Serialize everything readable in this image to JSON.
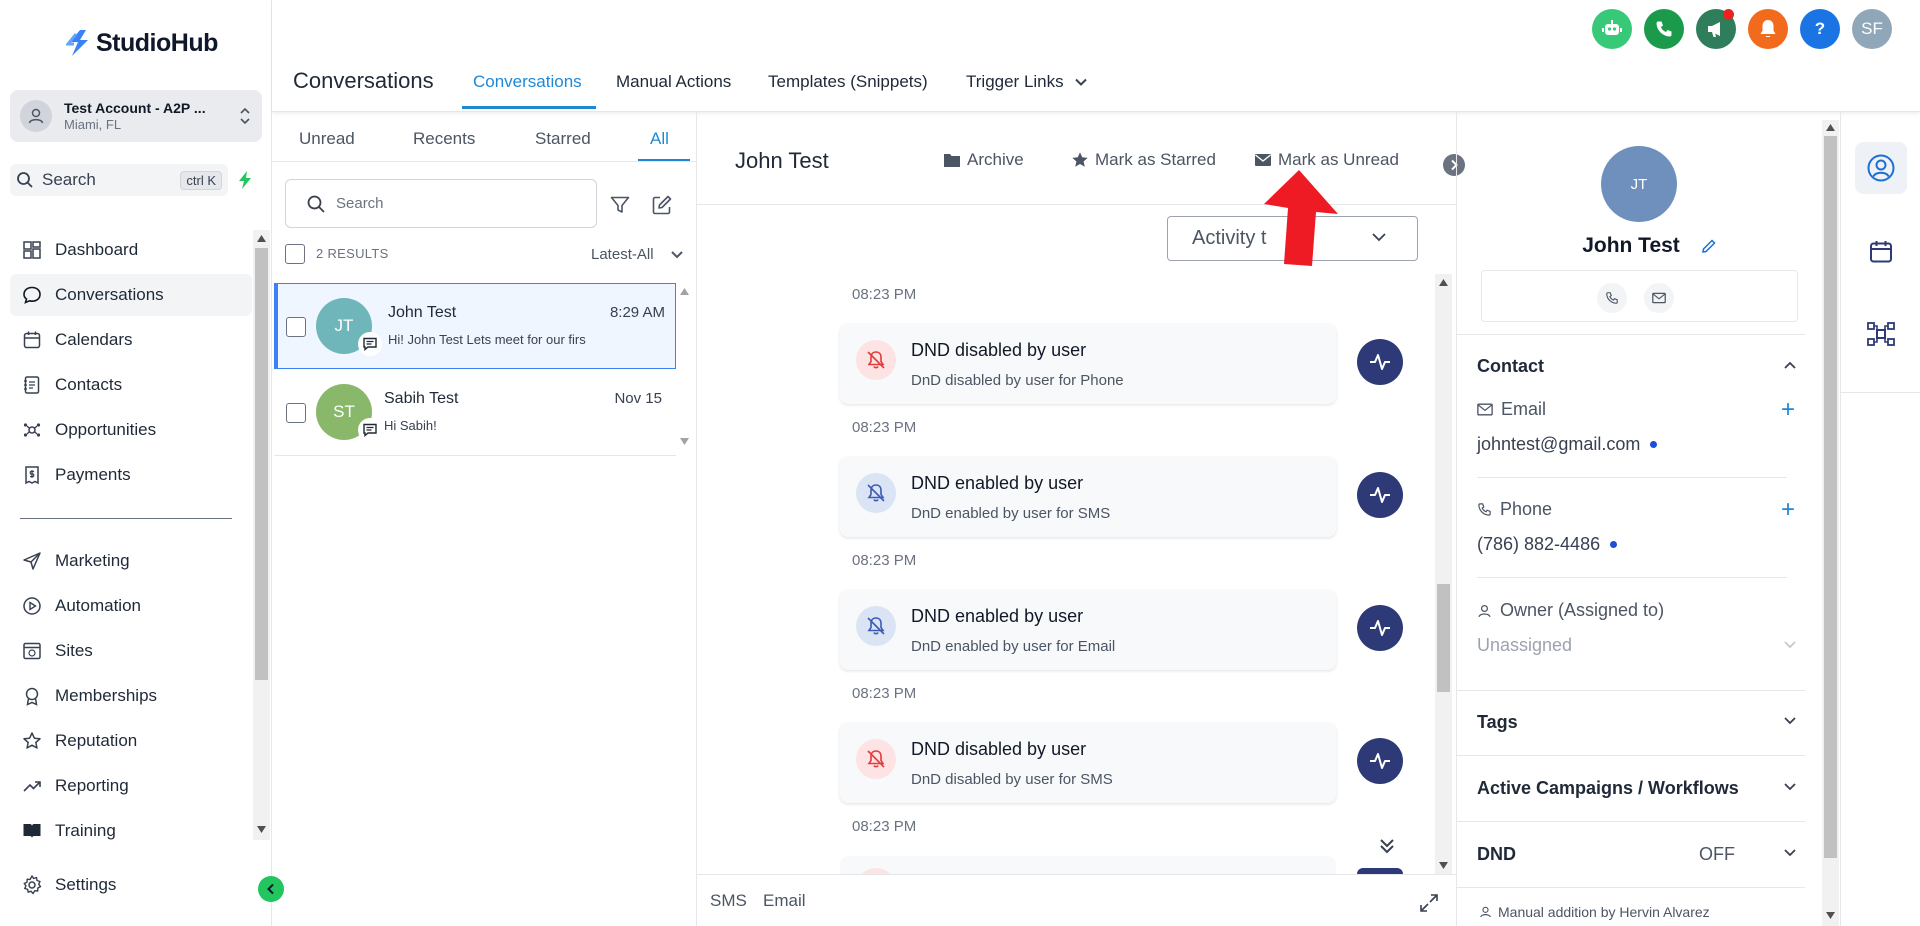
{
  "app": {
    "name": "StudioHub"
  },
  "account": {
    "name": "Test Account - A2P ...",
    "location": "Miami, FL"
  },
  "sidebar": {
    "search_label": "Search",
    "search_shortcut": "ctrl K",
    "items": [
      {
        "label": "Dashboard"
      },
      {
        "label": "Conversations"
      },
      {
        "label": "Calendars"
      },
      {
        "label": "Contacts"
      },
      {
        "label": "Opportunities"
      },
      {
        "label": "Payments"
      },
      {
        "label": "Marketing"
      },
      {
        "label": "Automation"
      },
      {
        "label": "Sites"
      },
      {
        "label": "Memberships"
      },
      {
        "label": "Reputation"
      },
      {
        "label": "Reporting"
      },
      {
        "label": "Training"
      },
      {
        "label": "Settings"
      }
    ]
  },
  "header": {
    "title": "Conversations",
    "tabs": [
      {
        "label": "Conversations"
      },
      {
        "label": "Manual Actions"
      },
      {
        "label": "Templates (Snippets)"
      },
      {
        "label": "Trigger Links"
      }
    ],
    "user_initials": "SF",
    "help_label": "?",
    "colors": {
      "bot": "#37c978",
      "phone": "#1c9a4c",
      "announce": "#2e7d5b",
      "bell": "#f26a1b",
      "help": "#1b74e4",
      "avatar": "#8fa7b8"
    }
  },
  "list": {
    "tabs": [
      {
        "label": "Unread"
      },
      {
        "label": "Recents"
      },
      {
        "label": "Starred"
      },
      {
        "label": "All"
      }
    ],
    "search_placeholder": "Search",
    "results": "2 RESULTS",
    "sort": "Latest-All",
    "conversations": [
      {
        "initials": "JT",
        "name": "John Test",
        "time": "8:29 AM",
        "preview": "Hi! John Test Lets meet for our firs",
        "color": "#6fb6ba"
      },
      {
        "initials": "ST",
        "name": "Sabih Test",
        "time": "Nov 15",
        "preview": "Hi Sabih!",
        "color": "#8ab86a"
      }
    ]
  },
  "chat": {
    "contact_name": "John Test",
    "actions": {
      "archive": "Archive",
      "star": "Mark as Starred",
      "unread": "Mark as Unread"
    },
    "filter": "Activity t",
    "timestamps": [
      "08:23 PM",
      "08:23 PM",
      "08:23 PM",
      "08:23 PM",
      "08:23 PM"
    ],
    "activities": [
      {
        "title": "DND disabled by user",
        "detail": "DnD disabled by user for Phone",
        "kind": "disabled"
      },
      {
        "title": "DND enabled by user",
        "detail": "DnD enabled by user for SMS",
        "kind": "enabled"
      },
      {
        "title": "DND enabled by user",
        "detail": "DnD enabled by user for Email",
        "kind": "enabled"
      },
      {
        "title": "DND disabled by user",
        "detail": "DnD disabled by user for SMS",
        "kind": "disabled"
      }
    ],
    "footer_tabs": [
      {
        "label": "SMS"
      },
      {
        "label": "Email"
      }
    ]
  },
  "contact": {
    "initials": "JT",
    "name": "John Test",
    "section_contact": "Contact",
    "email_label": "Email",
    "email": "johntest@gmail.com",
    "phone_label": "Phone",
    "phone": "(786) 882-4486",
    "owner_label": "Owner (Assigned to)",
    "owner": "Unassigned",
    "tags_label": "Tags",
    "campaigns_label": "Active Campaigns / Workflows",
    "dnd_label": "DND",
    "dnd_value": "OFF",
    "manual_note": "Manual addition by Hervin Alvarez"
  }
}
